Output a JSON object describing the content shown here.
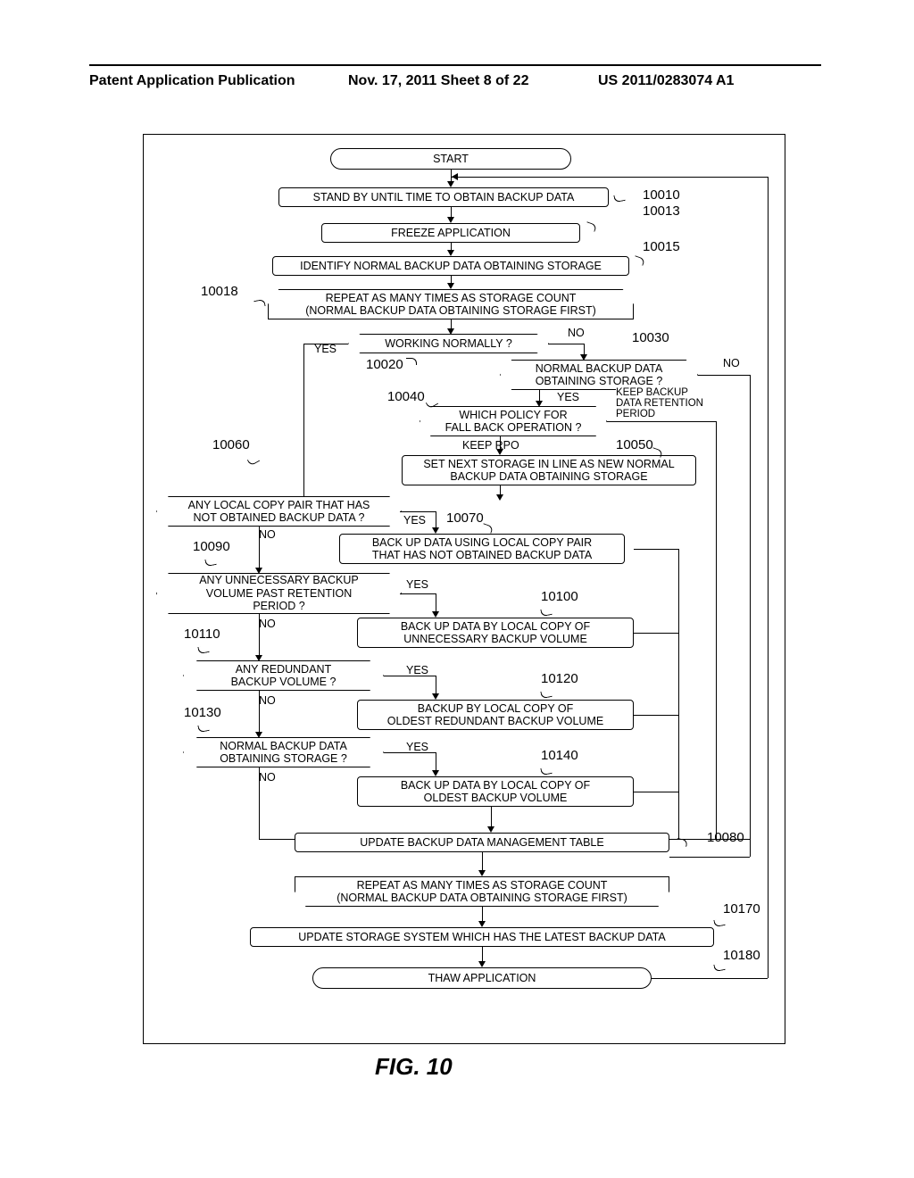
{
  "header": {
    "left": "Patent Application Publication",
    "mid": "Nov. 17, 2011  Sheet 8 of 22",
    "right": "US 2011/0283074 A1"
  },
  "nodes": {
    "start": "START",
    "n10010": "STAND BY UNTIL TIME TO OBTAIN BACKUP DATA",
    "n10013": "FREEZE APPLICATION",
    "n10015": "IDENTIFY NORMAL BACKUP DATA OBTAINING STORAGE",
    "n10018": "REPEAT AS MANY TIMES AS STORAGE COUNT\n(NORMAL BACKUP DATA OBTAINING STORAGE FIRST)",
    "n10020": "WORKING NORMALLY ?",
    "n10030": "NORMAL BACKUP DATA\nOBTAINING STORAGE ?",
    "n10040": "WHICH POLICY FOR\nFALL BACK OPERATION ?",
    "n10040alt": "KEEP BACKUP\nDATA RETENTION\nPERIOD",
    "n10050": "SET NEXT STORAGE IN LINE AS NEW NORMAL\nBACKUP DATA OBTAINING STORAGE",
    "n10060_branch": "KEEP RPO",
    "n10060": "ANY LOCAL COPY PAIR THAT HAS\nNOT OBTAINED BACKUP DATA ?",
    "n10070": "BACK UP DATA USING LOCAL COPY PAIR\nTHAT HAS NOT OBTAINED BACKUP DATA",
    "n10090": "ANY UNNECESSARY BACKUP\nVOLUME PAST RETENTION\nPERIOD ?",
    "n10100": "BACK UP DATA BY LOCAL COPY OF\nUNNECESSARY BACKUP VOLUME",
    "n10110": "ANY REDUNDANT\nBACKUP VOLUME ?",
    "n10120": "BACKUP BY LOCAL COPY OF\nOLDEST REDUNDANT BACKUP VOLUME",
    "n10130": "NORMAL BACKUP DATA\nOBTAINING STORAGE ?",
    "n10140": "BACK UP DATA BY LOCAL COPY OF\nOLDEST BACKUP VOLUME",
    "n10080": "UPDATE BACKUP DATA MANAGEMENT TABLE",
    "nloopend": "REPEAT AS MANY TIMES AS STORAGE COUNT\n(NORMAL BACKUP DATA OBTAINING STORAGE FIRST)",
    "n10170": "UPDATE STORAGE SYSTEM WHICH HAS THE LATEST BACKUP DATA",
    "n10180": "THAW APPLICATION"
  },
  "labels": {
    "yes": "YES",
    "no": "NO"
  },
  "refs": {
    "r10010": "10010",
    "r10013": "10013",
    "r10015": "10015",
    "r10018": "10018",
    "r10020": "10020",
    "r10030": "10030",
    "r10040": "10040",
    "r10050": "10050",
    "r10060": "10060",
    "r10070": "10070",
    "r10080": "10080",
    "r10090": "10090",
    "r10100": "10100",
    "r10110": "10110",
    "r10120": "10120",
    "r10130": "10130",
    "r10140": "10140",
    "r10170": "10170",
    "r10180": "10180"
  },
  "figure": "FIG. 10"
}
